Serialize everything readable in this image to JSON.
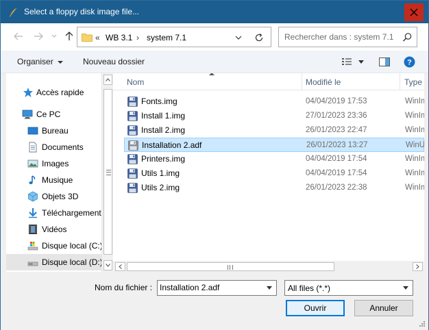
{
  "window": {
    "title": "Select a floppy disk image file..."
  },
  "nav": {
    "address": {
      "overflow": "«",
      "segments": [
        "WB 3.1",
        "system 7.1"
      ],
      "separator": "›"
    },
    "search_placeholder": "Rechercher dans : system 7.1"
  },
  "toolbar": {
    "organize": "Organiser",
    "new_folder": "Nouveau dossier"
  },
  "sidebar": {
    "items": [
      {
        "label": "Accès rapide",
        "icon": "star-icon"
      },
      {
        "label": "Ce PC",
        "icon": "computer-icon"
      },
      {
        "label": "Bureau",
        "icon": "desktop-icon"
      },
      {
        "label": "Documents",
        "icon": "documents-icon"
      },
      {
        "label": "Images",
        "icon": "pictures-icon"
      },
      {
        "label": "Musique",
        "icon": "music-icon"
      },
      {
        "label": "Objets 3D",
        "icon": "objects-3d-icon"
      },
      {
        "label": "Téléchargements",
        "icon": "downloads-icon"
      },
      {
        "label": "Vidéos",
        "icon": "videos-icon"
      },
      {
        "label": "Disque local (C:)",
        "icon": "drive-c-icon"
      },
      {
        "label": "Disque local (D:)",
        "icon": "drive-d-icon"
      }
    ],
    "selected": "Disque local (D:)"
  },
  "files": {
    "columns": {
      "name": "Nom",
      "modified": "Modifié le",
      "type": "Type"
    },
    "rows": [
      {
        "name": "Fonts.img",
        "modified": "04/04/2019 17:53",
        "type": "WinIm"
      },
      {
        "name": "Install 1.img",
        "modified": "27/01/2023 23:36",
        "type": "WinIm"
      },
      {
        "name": "Install 2.img",
        "modified": "26/01/2023 22:47",
        "type": "WinIm"
      },
      {
        "name": "Installation 2.adf",
        "modified": "26/01/2023 13:27",
        "type": "WinUA"
      },
      {
        "name": "Printers.img",
        "modified": "04/04/2019 17:54",
        "type": "WinIm"
      },
      {
        "name": "Utils 1.img",
        "modified": "04/04/2019 17:54",
        "type": "WinIm"
      },
      {
        "name": "Utils 2.img",
        "modified": "26/01/2023 22:38",
        "type": "WinIm"
      }
    ],
    "selected": "Installation 2.adf"
  },
  "footer": {
    "filename_label": "Nom du fichier :",
    "filename_value": "Installation 2.adf",
    "filter_value": "All files (*.*)",
    "open_label": "Ouvrir",
    "cancel_label": "Annuler"
  },
  "colors": {
    "titlebar": "#1c5e8f",
    "close": "#c42b1c",
    "selection": "#cce8ff",
    "accent": "#0078d7"
  }
}
